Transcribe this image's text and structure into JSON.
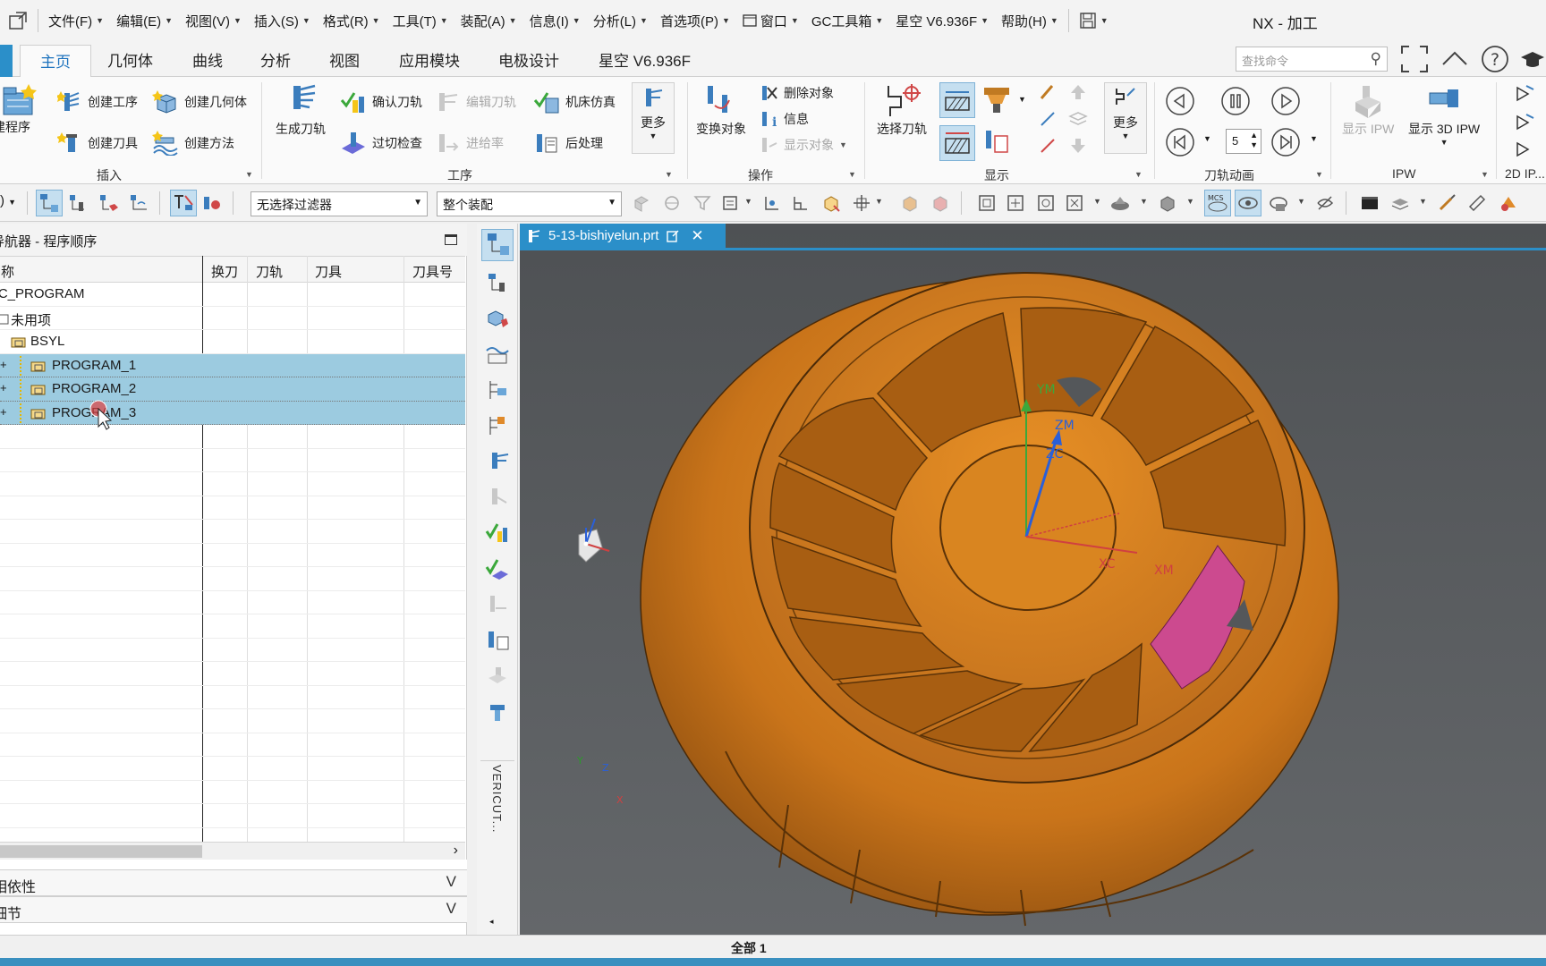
{
  "window": {
    "title": "NX - 加工"
  },
  "menubar": {
    "items": [
      {
        "label": "文件(F)"
      },
      {
        "label": "编辑(E)"
      },
      {
        "label": "视图(V)"
      },
      {
        "label": "插入(S)"
      },
      {
        "label": "格式(R)"
      },
      {
        "label": "工具(T)"
      },
      {
        "label": "装配(A)"
      },
      {
        "label": "信息(I)"
      },
      {
        "label": "分析(L)"
      },
      {
        "label": "首选项(P)"
      },
      {
        "label": "窗口"
      },
      {
        "label": "GC工具箱"
      },
      {
        "label": "星空 V6.936F"
      },
      {
        "label": "帮助(H)"
      }
    ]
  },
  "ribbon": {
    "tabs": [
      "主页",
      "几何体",
      "曲线",
      "分析",
      "视图",
      "应用模块",
      "电极设计",
      "星空 V6.936F"
    ],
    "active_tab": "主页",
    "search_placeholder": "查找命令",
    "groups": {
      "insert": {
        "label": "插入",
        "create_program": "创建程序",
        "create_operation": "创建工序",
        "create_geometry": "创建几何体",
        "create_tool": "创建刀具",
        "create_method": "创建方法"
      },
      "operation": {
        "label": "工序",
        "generate_toolpath": "生成刀轨",
        "confirm_toolpath": "确认刀轨",
        "edit_toolpath": "编辑刀轨",
        "machine_sim": "机床仿真",
        "gouge_check": "过切检查",
        "feed_rate": "进给率",
        "post_process": "后处理",
        "more": "更多"
      },
      "actions": {
        "label": "操作",
        "transform_object": "变换对象",
        "delete_object": "删除对象",
        "info": "信息",
        "display_object": "显示对象"
      },
      "display": {
        "label": "显示",
        "select_toolpath": "选择刀轨",
        "more": "更多"
      },
      "animation": {
        "label": "刀轨动画",
        "speed_value": "5"
      },
      "ipw": {
        "label": "IPW",
        "show_ipw": "显示 IPW",
        "show_3d_ipw": "显示 3D IPW"
      },
      "ip2d": {
        "label": "2D IP..."
      }
    }
  },
  "toolbar2": {
    "filter_value": "无选择过滤器",
    "assembly_value": "整个装配"
  },
  "navigator": {
    "title": "导航器 - 程序顺序",
    "columns": [
      "名称",
      "换刀",
      "刀轨",
      "刀具",
      "刀具号"
    ],
    "rows": [
      {
        "label": "NC_PROGRAM",
        "selected": false
      },
      {
        "label": "未用项",
        "selected": false
      },
      {
        "label": "BSYL",
        "selected": false
      },
      {
        "label": "PROGRAM_1",
        "selected": true
      },
      {
        "label": "PROGRAM_2",
        "selected": true
      },
      {
        "label": "PROGRAM_3",
        "selected": true
      }
    ],
    "panels": [
      "相依性",
      "细节"
    ]
  },
  "resource_bar": {
    "vericut_label": "VERICUT..."
  },
  "document": {
    "tab_label": "5-13-bishiyelun.prt"
  },
  "graphics": {
    "axis_labels": {
      "ym": "YM",
      "zm": "ZM",
      "zc": "ZC",
      "xc": "XC",
      "xm": "XM"
    },
    "triad": {
      "y": "Y",
      "z": "Z",
      "x": "X"
    },
    "colors": {
      "part": "#d7811c",
      "highlight": "#d0448f",
      "background": "#56595c"
    }
  },
  "status": {
    "text": "全部 1"
  },
  "colors": {
    "accent": "#2b8fc9",
    "selection": "#9ccbe0"
  }
}
